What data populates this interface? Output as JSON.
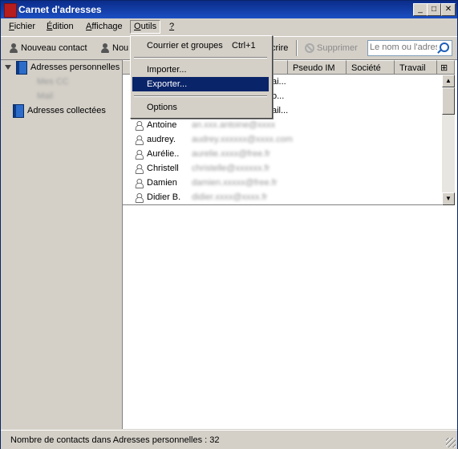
{
  "window": {
    "title": "Carnet d'adresses"
  },
  "menu": {
    "items": [
      {
        "pre": "",
        "key": "F",
        "post": "ichier"
      },
      {
        "pre": "",
        "key": "É",
        "post": "dition"
      },
      {
        "pre": "",
        "key": "A",
        "post": "ffichage"
      },
      {
        "pre": "",
        "key": "O",
        "post": "utils"
      },
      {
        "pre": "",
        "key": "?",
        "post": ""
      }
    ]
  },
  "toolbar": {
    "new_contact": "Nouveau contact",
    "new_list": "Nou",
    "write": "crire",
    "delete": "Supprimer",
    "search_placeholder": "Le nom ou l'adres"
  },
  "sidebar": {
    "personal": "Adresses personnelles",
    "sub1": "Mes CC",
    "sub2": "Mail",
    "collected": "Adresses collectées"
  },
  "columns": {
    "im": "Pseudo IM",
    "company": "Société",
    "work": "Travail"
  },
  "contacts": [
    {
      "name": "",
      "email": "ai..."
    },
    {
      "name": "",
      "email": "o..."
    },
    {
      "name": "",
      "email": "ail..."
    },
    {
      "name": "Antoine",
      "email": "an.xxx.antoine@xxxx"
    },
    {
      "name": "audrey.",
      "email": "audrey.xxxxxx@xxxx.com"
    },
    {
      "name": "Aurélie..",
      "email": "aurelie.xxxx@free.fr"
    },
    {
      "name": "Christell",
      "email": "christelle@xxxxxx.fr"
    },
    {
      "name": "Damien",
      "email": "damien.xxxxx@free.fr"
    },
    {
      "name": "Didier B.",
      "email": "didier.xxxx@xxxx.fr"
    }
  ],
  "tools_menu": {
    "mail_groups": "Courrier et groupes",
    "mail_groups_shortcut": "Ctrl+1",
    "import": "Importer...",
    "export": "Exporter...",
    "options": "Options"
  },
  "status": {
    "text": "Nombre de contacts dans Adresses personnelles : 32"
  }
}
